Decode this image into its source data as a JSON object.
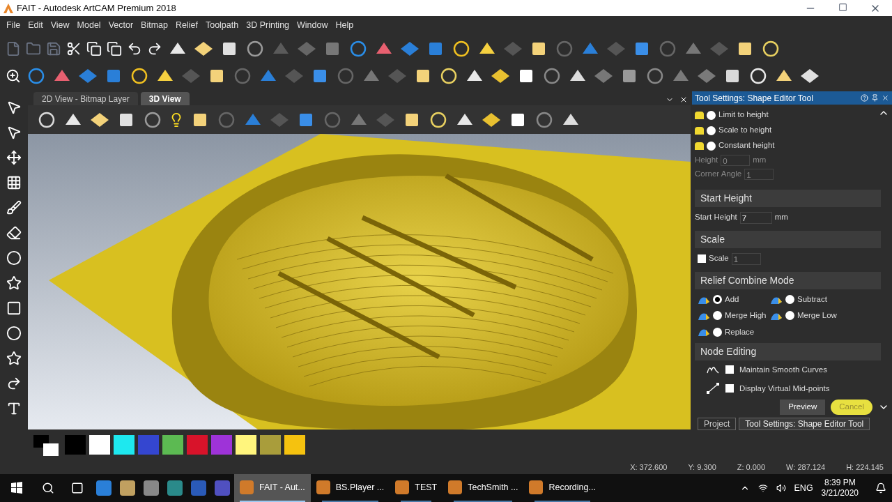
{
  "window": {
    "title": "FAIT - Autodesk ArtCAM Premium 2018"
  },
  "menu": [
    "File",
    "Edit",
    "View",
    "Model",
    "Vector",
    "Bitmap",
    "Relief",
    "Toolpath",
    "3D Printing",
    "Window",
    "Help"
  ],
  "view_tabs": [
    {
      "label": "2D View - Bitmap Layer",
      "selected": false
    },
    {
      "label": "3D View",
      "selected": true
    }
  ],
  "palette": [
    {
      "color": "#000000"
    },
    {
      "color": "#ffffff"
    },
    {
      "color": "#1ee8ef"
    },
    {
      "color": "#3446d0"
    },
    {
      "color": "#5cba52"
    },
    {
      "color": "#d8132a"
    },
    {
      "color": "#9e33d8"
    },
    {
      "color": "#fff57d"
    },
    {
      "color": "#a99d3b"
    },
    {
      "color": "#f5c20f"
    }
  ],
  "tool_settings": {
    "title": "Tool Settings: Shape Editor Tool",
    "limit_options": [
      {
        "label": "Limit to height",
        "selected": false
      },
      {
        "label": "Scale to height",
        "selected": false
      },
      {
        "label": "Constant height",
        "selected": false
      }
    ],
    "height": {
      "label": "Height",
      "value": "0",
      "unit": "mm",
      "disabled": true
    },
    "corner_angle": {
      "label": "Corner Angle",
      "value": "1",
      "disabled": true
    },
    "start_height": {
      "heading": "Start Height",
      "label": "Start Height",
      "value": "7",
      "unit": "mm"
    },
    "scale": {
      "heading": "Scale",
      "label": "Scale",
      "value": "1",
      "checked": false
    },
    "relief_combine": {
      "heading": "Relief Combine Mode",
      "options": [
        {
          "label": "Add",
          "selected": true
        },
        {
          "label": "Subtract",
          "selected": false
        },
        {
          "label": "Merge High",
          "selected": false
        },
        {
          "label": "Merge Low",
          "selected": false
        },
        {
          "label": "Replace",
          "selected": false
        }
      ]
    },
    "node_editing": {
      "heading": "Node Editing",
      "options": [
        {
          "label": "Maintain Smooth Curves",
          "checked": false
        },
        {
          "label": "Display Virtual Mid-points",
          "checked": false
        }
      ]
    },
    "buttons": [
      "Preview",
      "Cancel"
    ]
  },
  "panel_tabs": [
    {
      "label": "Project",
      "selected": false
    },
    {
      "label": "Tool Settings: Shape Editor Tool",
      "selected": true
    }
  ],
  "status_bar": [
    "X: 372.600",
    "Y: 9.300",
    "Z: 0.000",
    "W: 287.124",
    "H: 224.145"
  ],
  "taskbar": {
    "apps": [
      {
        "label": "FAIT - Aut...",
        "active": true
      },
      {
        "label": "BS.Player ...",
        "active": false
      },
      {
        "label": "TEST",
        "active": false
      },
      {
        "label": "TechSmith ...",
        "active": false
      },
      {
        "label": "Recording...",
        "active": false
      }
    ],
    "language": "ENG",
    "time": "8:39 PM",
    "date": "3/21/2020"
  }
}
